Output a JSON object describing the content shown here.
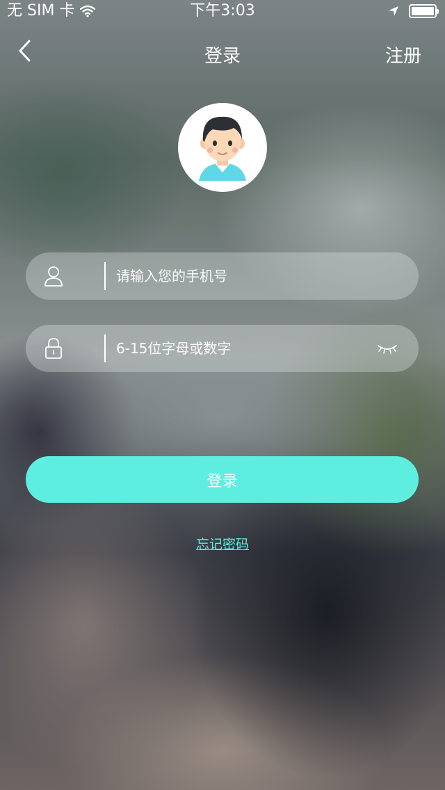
{
  "status_bar": {
    "carrier": "无 SIM 卡",
    "time": "下午3:03",
    "icons": [
      "wifi-icon",
      "location-arrow-icon",
      "battery-icon"
    ]
  },
  "nav": {
    "back_icon": "chevron-left-icon",
    "title": "登录",
    "register_label": "注册"
  },
  "avatar": {
    "icon": "boy-avatar"
  },
  "form": {
    "phone": {
      "icon": "user-icon",
      "placeholder": "请输入您的手机号",
      "value": ""
    },
    "password": {
      "icon": "lock-icon",
      "placeholder": "6-15位字母或数字",
      "value": "",
      "toggle_icon": "eye-closed-icon"
    }
  },
  "login_button": {
    "label": "登录",
    "color": "#5eeee0"
  },
  "forgot_link": {
    "label": "忘记密码",
    "color": "#5eeee0"
  }
}
